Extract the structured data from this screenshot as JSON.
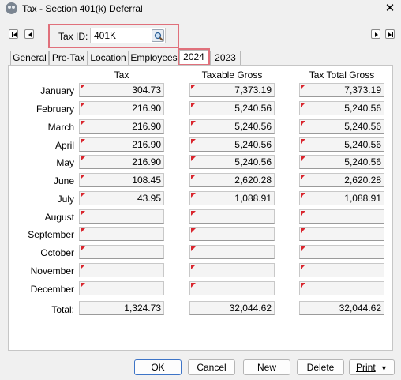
{
  "window": {
    "title": "Tax - Section 401(k) Deferral",
    "title_icon": "users-icon",
    "close_glyph": "✕"
  },
  "taxid": {
    "label": "Tax ID:",
    "value": "401K",
    "search_icon": "magnifier-icon"
  },
  "nav": {
    "first": "first-record-icon",
    "prev": "previous-record-icon",
    "next": "next-record-icon",
    "last": "last-record-icon"
  },
  "tabs": [
    {
      "label": "General",
      "active": false
    },
    {
      "label": "Pre-Tax",
      "active": false
    },
    {
      "label": "Location",
      "active": false
    },
    {
      "label": "Employees",
      "active": false
    },
    {
      "label": "2024",
      "active": true
    },
    {
      "label": "2023",
      "active": false
    }
  ],
  "table": {
    "headers": [
      "Tax",
      "Taxable Gross",
      "Tax Total Gross"
    ],
    "rows": [
      {
        "month": "January",
        "tax": "304.73",
        "gross": "7,373.19",
        "tgross": "7,373.19"
      },
      {
        "month": "February",
        "tax": "216.90",
        "gross": "5,240.56",
        "tgross": "5,240.56"
      },
      {
        "month": "March",
        "tax": "216.90",
        "gross": "5,240.56",
        "tgross": "5,240.56"
      },
      {
        "month": "April",
        "tax": "216.90",
        "gross": "5,240.56",
        "tgross": "5,240.56"
      },
      {
        "month": "May",
        "tax": "216.90",
        "gross": "5,240.56",
        "tgross": "5,240.56"
      },
      {
        "month": "June",
        "tax": "108.45",
        "gross": "2,620.28",
        "tgross": "2,620.28"
      },
      {
        "month": "July",
        "tax": "43.95",
        "gross": "1,088.91",
        "tgross": "1,088.91"
      },
      {
        "month": "August",
        "tax": "",
        "gross": "",
        "tgross": ""
      },
      {
        "month": "September",
        "tax": "",
        "gross": "",
        "tgross": ""
      },
      {
        "month": "October",
        "tax": "",
        "gross": "",
        "tgross": ""
      },
      {
        "month": "November",
        "tax": "",
        "gross": "",
        "tgross": ""
      },
      {
        "month": "December",
        "tax": "",
        "gross": "",
        "tgross": ""
      }
    ],
    "total": {
      "label": "Total:",
      "tax": "1,324.73",
      "gross": "32,044.62",
      "tgross": "32,044.62"
    }
  },
  "buttons": {
    "ok": "OK",
    "cancel": "Cancel",
    "new": "New",
    "delete": "Delete",
    "print": "Print",
    "print_arrow": "▼"
  },
  "colors": {
    "highlight": "#e0707b",
    "edit_mark": "#d9262e",
    "default_button_border": "#3d74c7"
  }
}
